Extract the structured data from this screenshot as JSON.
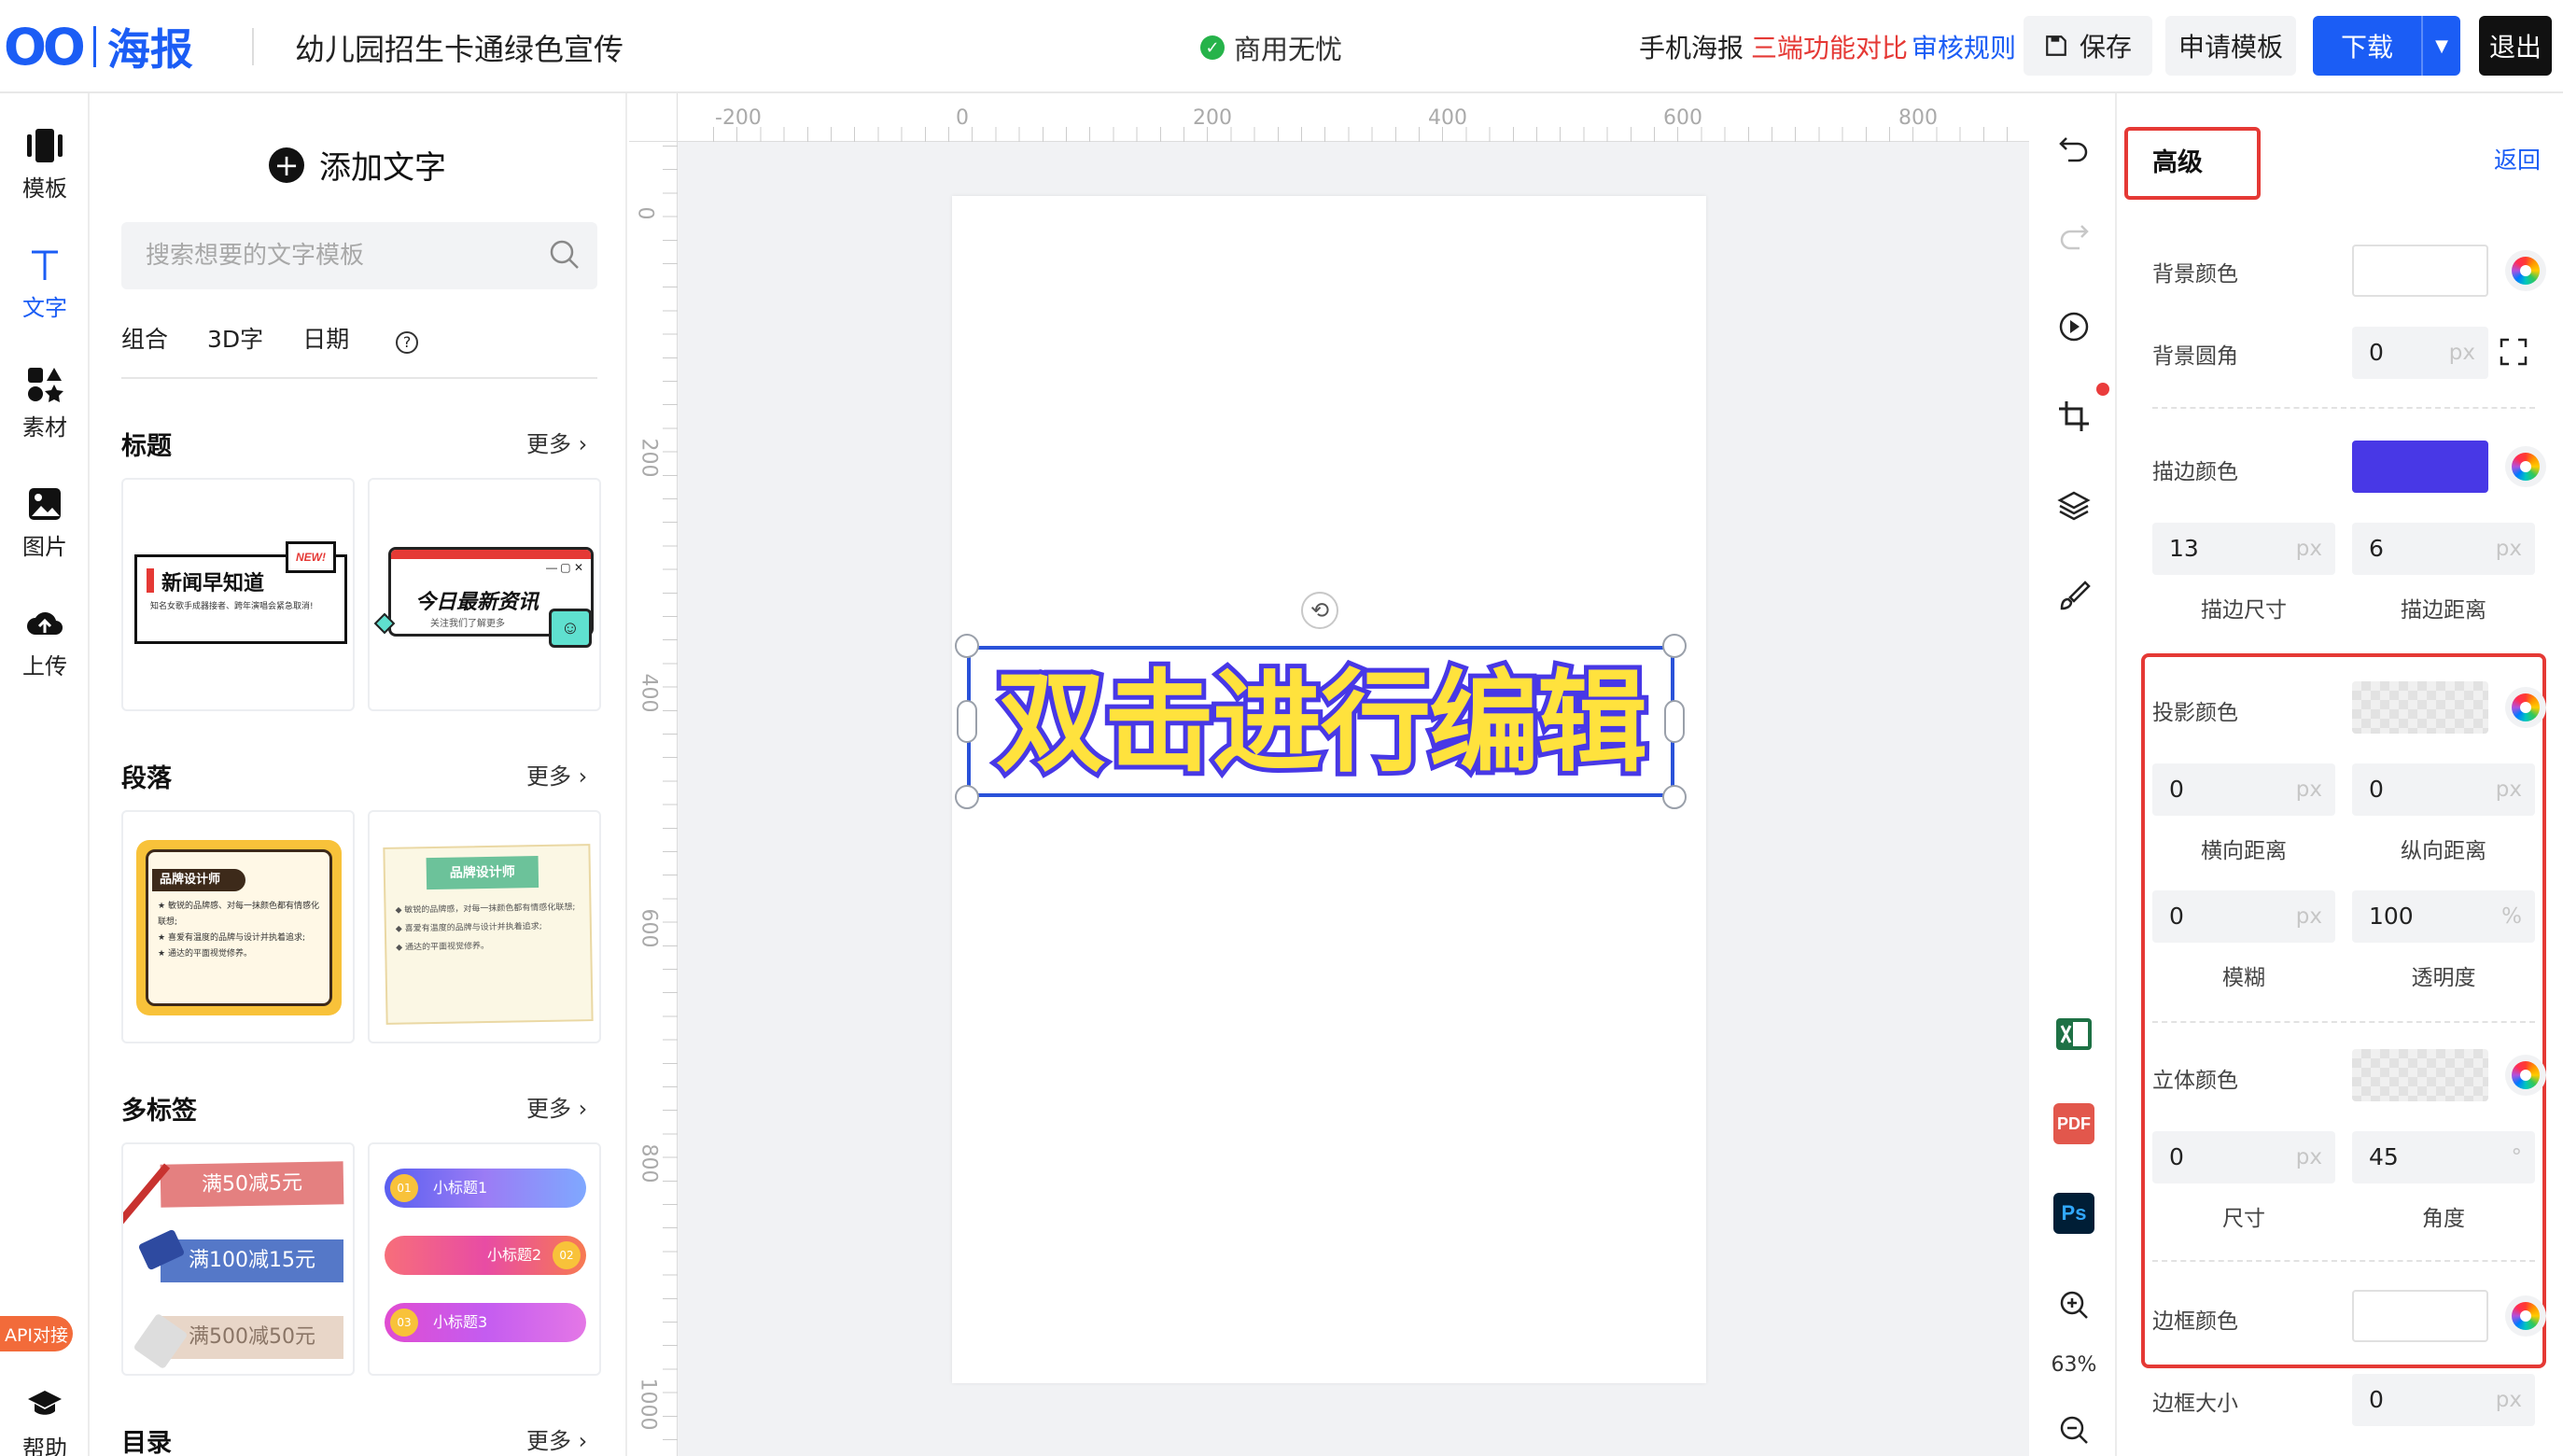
{
  "header": {
    "brand_logo": "OO",
    "brand_name": "海报",
    "doc_title": "幼儿园招生卡通绿色宣传",
    "commercial": "商用无忧",
    "link_mobile": "手机海报",
    "link_compare": "三端功能对比",
    "link_rules": "审核规则",
    "save": "保存",
    "apply_template": "申请模板",
    "download": "下载",
    "exit": "退出",
    "colors": {
      "brand": "#1b5df5",
      "compare": "#e53935",
      "rules": "#1b5df5"
    }
  },
  "rail": {
    "items": [
      {
        "label": "模板",
        "icon": "template-icon"
      },
      {
        "label": "文字",
        "icon": "text-icon"
      },
      {
        "label": "素材",
        "icon": "elements-icon"
      },
      {
        "label": "图片",
        "icon": "image-icon"
      },
      {
        "label": "上传",
        "icon": "upload-icon"
      }
    ],
    "api_badge": "API对接",
    "help": "帮助"
  },
  "panel": {
    "add_text": "添加文字",
    "search_placeholder": "搜索想要的文字模板",
    "subtabs": [
      "组合",
      "3D字",
      "日期"
    ],
    "more": "更多",
    "sections": [
      {
        "title": "标题"
      },
      {
        "title": "段落"
      },
      {
        "title": "多标签"
      },
      {
        "title": "目录"
      }
    ],
    "cards": {
      "news_title": "新闻早知道",
      "news_badge": "NEW!",
      "news_body": "知名女歌手成器接者、跨年演唱会紧急取消!",
      "today_title": "今日最新资讯",
      "today_sub": "关注我们了解更多",
      "brand1_title": "品牌设计师",
      "brand1_lines": [
        "敏锐的品牌感、对每一抹颜色都有情感化联想;",
        "喜爱有温度的品牌与设计并执着追求;",
        "通达的平面视觉修养。"
      ],
      "brand2_title": "品牌设计师",
      "brand2_lines": [
        "敏锐的品牌感，对每一抹颜色都有情感化联想;",
        "喜爱有温度的品牌与设计并执着追求;",
        "通达的平面视觉修养。"
      ],
      "tag1": "满50减5元",
      "tag2": "满100减15元",
      "tag3": "满500减50元",
      "pill1_num": "01",
      "pill1": "小标题1",
      "pill2_num": "02",
      "pill2": "小标题2",
      "pill3_num": "03",
      "pill3": "小标题3"
    }
  },
  "stage": {
    "ruler_h": [
      "-200",
      "0",
      "200",
      "400",
      "600",
      "800"
    ],
    "ruler_v": [
      "0",
      "200",
      "400",
      "600",
      "800",
      "1000"
    ],
    "text": "双击进行编辑",
    "text_fill": "#ffe23d",
    "text_stroke": "#4838e6"
  },
  "tools": {
    "icons": [
      "undo-icon",
      "redo-icon",
      "play-icon",
      "crop-icon",
      "layers-icon",
      "brush-icon",
      "excel-icon",
      "pdf-icon",
      "ps-icon",
      "zoom-in-icon",
      "zoom-out-icon"
    ],
    "zoom": "63%",
    "pdf": "PDF",
    "ps": "Ps"
  },
  "props": {
    "title": "高级",
    "back": "返回",
    "bg_color": "背景颜色",
    "bg_radius": "背景圆角",
    "bg_radius_value": "0",
    "stroke_color": "描边颜色",
    "stroke_color_hex": "#4838e6",
    "stroke_size_value": "13",
    "stroke_offset_value": "6",
    "stroke_size": "描边尺寸",
    "stroke_offset": "描边距离",
    "shadow_color": "投影颜色",
    "shadow_x_value": "0",
    "shadow_y_value": "0",
    "shadow_x": "横向距离",
    "shadow_y": "纵向距离",
    "blur_value": "0",
    "opacity_value": "100",
    "blur": "模糊",
    "opacity": "透明度",
    "solid_color": "立体颜色",
    "solid_size_value": "0",
    "solid_angle_value": "45",
    "solid_size": "尺寸",
    "solid_angle": "角度",
    "border_color": "边框颜色",
    "border_size": "边框大小",
    "border_size_value": "0",
    "unit_px": "px",
    "unit_pct": "%",
    "unit_deg": "°"
  }
}
